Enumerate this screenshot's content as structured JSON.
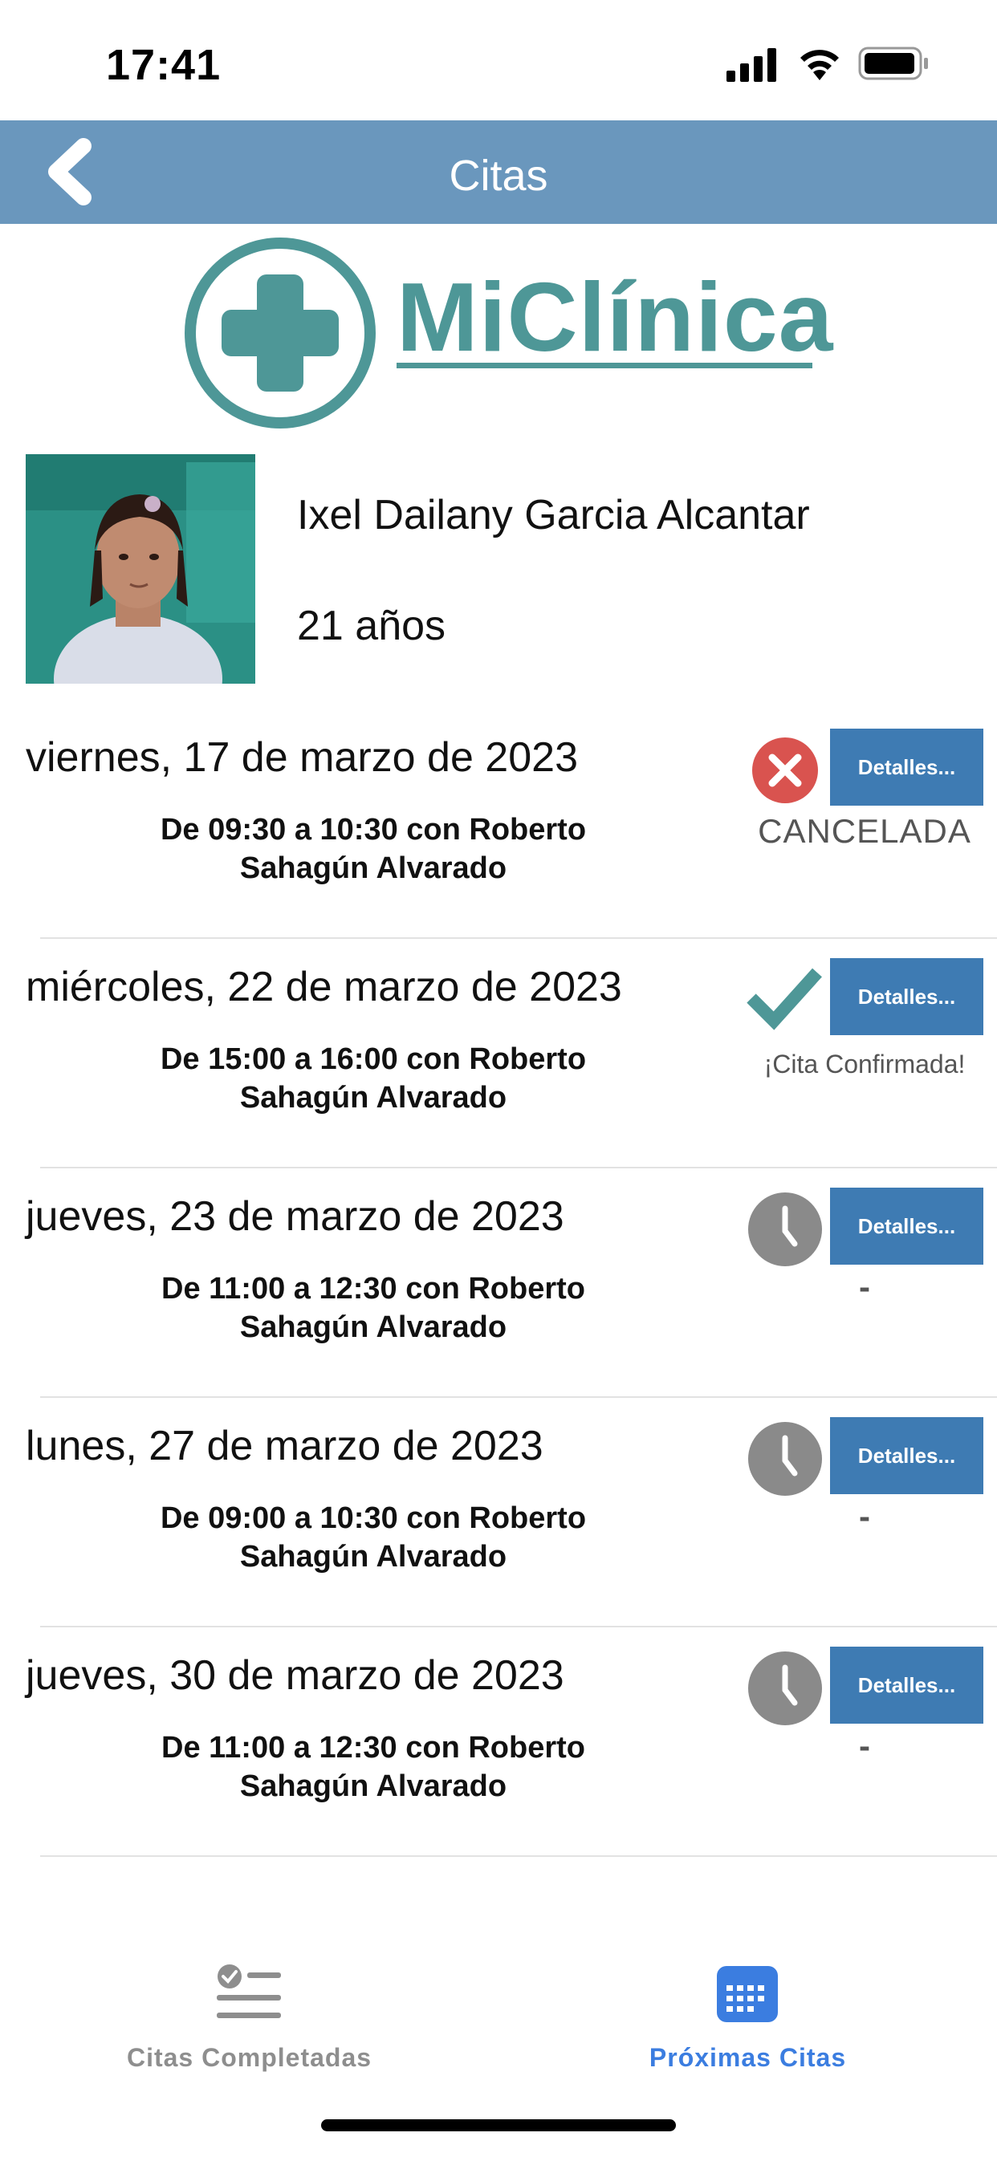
{
  "status_bar": {
    "time": "17:41"
  },
  "nav": {
    "title": "Citas"
  },
  "logo": {
    "text": "MiClínica",
    "color": "#4e9797"
  },
  "patient": {
    "name": "Ixel Dailany Garcia Alcantar",
    "age": "21 años"
  },
  "appointments": [
    {
      "date": "viernes, 17 de marzo de 2023",
      "detail_line1": "De 09:30 a 10:30 con Roberto",
      "detail_line2": "Sahagún Alvarado",
      "status_icon": "cancel-icon",
      "status_text": "CANCELADA",
      "button_label": "Detalles..."
    },
    {
      "date": "miércoles, 22 de marzo de 2023",
      "detail_line1": "De 15:00 a 16:00 con Roberto",
      "detail_line2": "Sahagún Alvarado",
      "status_icon": "check-icon",
      "status_text": "¡Cita Confirmada!",
      "button_label": "Detalles..."
    },
    {
      "date": "jueves, 23 de marzo de 2023",
      "detail_line1": "De 11:00 a 12:30 con Roberto",
      "detail_line2": "Sahagún Alvarado",
      "status_icon": "clock-icon",
      "status_text": "-",
      "button_label": "Detalles..."
    },
    {
      "date": "lunes, 27 de marzo de 2023",
      "detail_line1": "De 09:00 a 10:30 con Roberto",
      "detail_line2": "Sahagún Alvarado",
      "status_icon": "clock-icon",
      "status_text": "-",
      "button_label": "Detalles..."
    },
    {
      "date": "jueves, 30 de marzo de 2023",
      "detail_line1": "De 11:00 a 12:30 con Roberto",
      "detail_line2": "Sahagún Alvarado",
      "status_icon": "clock-icon",
      "status_text": "-",
      "button_label": "Detalles..."
    }
  ],
  "tabs": [
    {
      "label": "Citas Completadas",
      "icon": "checklist-icon",
      "active": false
    },
    {
      "label": "Próximas Citas",
      "icon": "calendar-icon",
      "active": true
    }
  ],
  "colors": {
    "nav_bar": "#6a97bd",
    "details_button": "#3e7bb3",
    "brand_teal": "#4e9797",
    "cancel_red": "#d9534f",
    "pending_gray": "#8a8a8a",
    "tab_active": "#3b7de0",
    "tab_inactive": "#8e8e8e"
  }
}
